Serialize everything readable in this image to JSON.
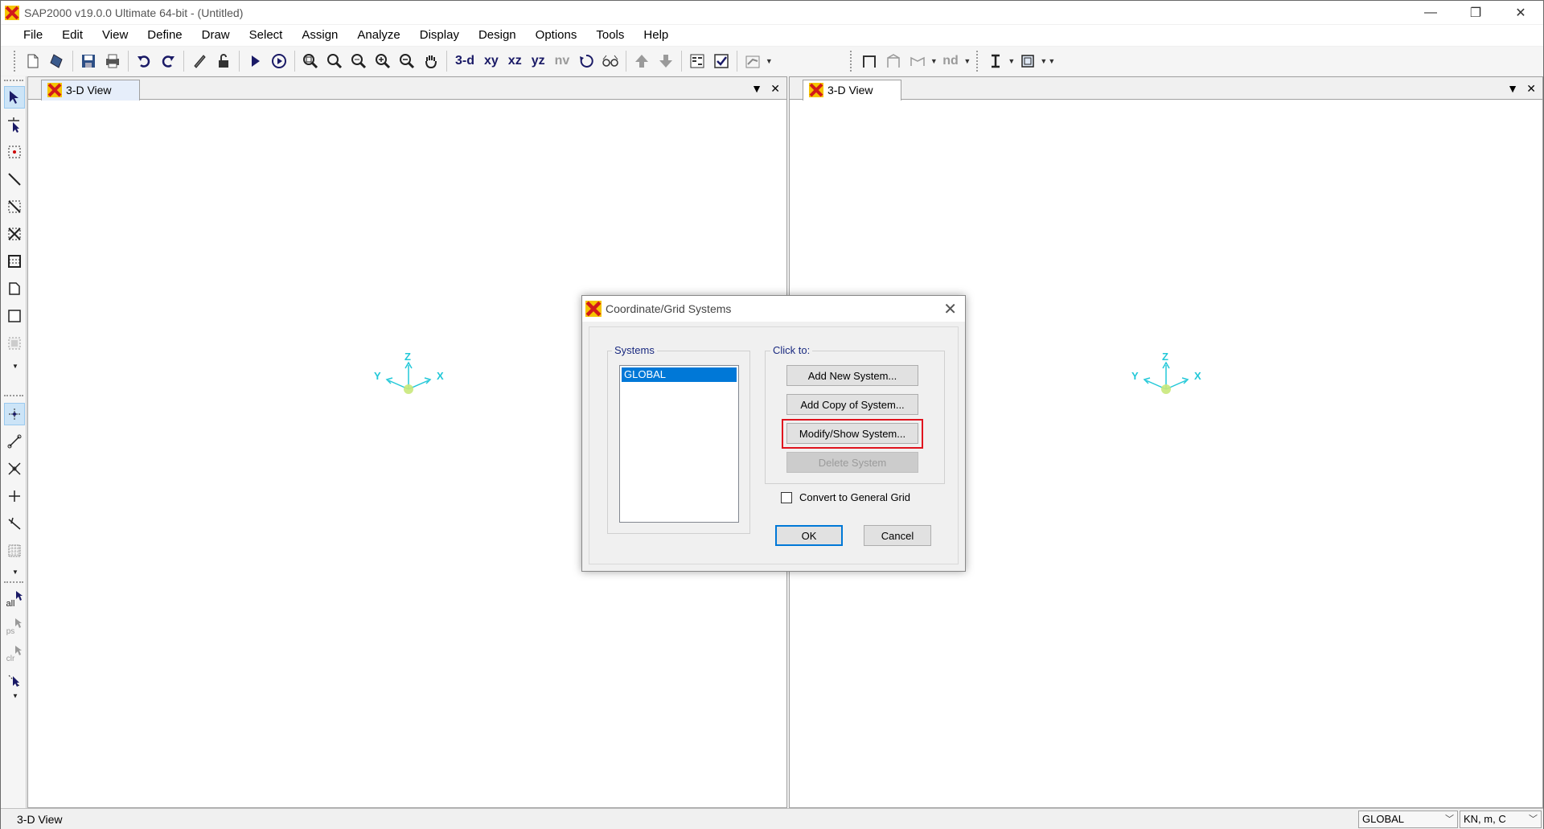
{
  "window": {
    "title": "SAP2000 v19.0.0 Ultimate 64-bit - (Untitled)",
    "minimize_glyph": "—",
    "restore_glyph": "❐",
    "close_glyph": "✕"
  },
  "menu": [
    "File",
    "Edit",
    "View",
    "Define",
    "Draw",
    "Select",
    "Assign",
    "Analyze",
    "Display",
    "Design",
    "Options",
    "Tools",
    "Help"
  ],
  "toolbar": {
    "view_3d": "3-d",
    "view_xy": "xy",
    "view_xz": "xz",
    "view_yz": "yz",
    "view_nv": "nv",
    "nd_label": "nd"
  },
  "left_toolbar": {
    "all_label": "all",
    "ps_label": "ps",
    "clr_label": "clr"
  },
  "panes": [
    {
      "tab_label": "3-D View",
      "axis_x": "X",
      "axis_y": "Y",
      "axis_z": "Z"
    },
    {
      "tab_label": "3-D View",
      "axis_x": "X",
      "axis_y": "Y",
      "axis_z": "Z"
    }
  ],
  "pane_controls": {
    "dropdown_glyph": "▼",
    "close_glyph": "✕"
  },
  "dialog": {
    "title": "Coordinate/Grid Systems",
    "systems_label": "Systems",
    "systems": [
      "GLOBAL"
    ],
    "click_to_label": "Click to:",
    "add_new": "Add New System...",
    "add_copy": "Add Copy of System...",
    "modify_show": "Modify/Show System...",
    "delete": "Delete System",
    "convert_label": "Convert to General Grid",
    "convert_checked": false,
    "ok": "OK",
    "cancel": "Cancel",
    "close_glyph": "✕"
  },
  "status": {
    "view_label": "3-D View",
    "coord_system": "GLOBAL",
    "units": "KN, m, C"
  },
  "colors": {
    "axis": "#22c8d8",
    "highlight": "#e0141e",
    "selection": "#0078d7",
    "group_label": "#1a2a80"
  }
}
